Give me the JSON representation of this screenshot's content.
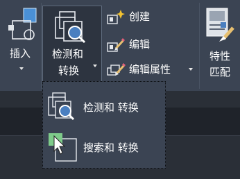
{
  "ribbon": {
    "insert_label": "插入",
    "detect_label_line1": "检测和",
    "detect_label_line2": "转换",
    "create_label": "创建",
    "edit_label": "编辑",
    "edit_attributes_label": "编辑属性",
    "match_label_line1": "特性",
    "match_label_line2": "匹配"
  },
  "dropdown": {
    "items": [
      {
        "label": "检测和 转换",
        "icon": "detect-convert-icon"
      },
      {
        "label": "搜索和 转换",
        "icon": "search-convert-icon"
      }
    ]
  },
  "colors": {
    "ribbon_bg": "#3b4453",
    "selected_bg": "#2d3440",
    "icon_blue": "#4a7fc0",
    "accent_green": "#7ecb8a",
    "text": "#ffffff"
  }
}
